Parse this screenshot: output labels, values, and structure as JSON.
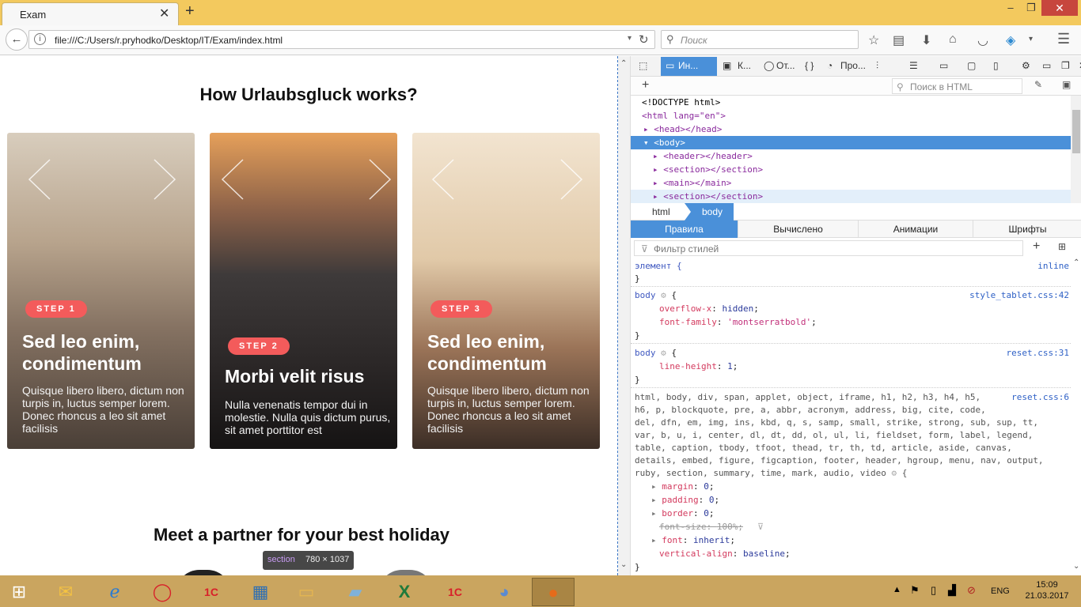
{
  "browser": {
    "tab_title": "Exam",
    "tab_close": "✕",
    "new_tab": "+",
    "url": "file:///C:/Users/r.pryhodko/Desktop/IT/Exam/index.html",
    "search_placeholder": "Поиск",
    "window_controls": [
      "–",
      "❐"
    ],
    "window_close": "✕"
  },
  "page": {
    "heading": "How Urlaubsgluck works?",
    "cards": [
      {
        "step": "STEP 1",
        "title": "Sed leo enim, condimentum",
        "text": "Quisque libero libero, dictum non turpis in, luctus semper lorem. Donec rhoncus a leo sit amet facilisis"
      },
      {
        "step": "STEP 2",
        "title": "Morbi velit risus",
        "text": "Nulla venenatis tempor dui in molestie. Nulla quis dictum purus, sit amet porttitor est"
      },
      {
        "step": "STEP 3",
        "title": "Sed leo enim, condimentum",
        "text": "Quisque libero libero, dictum non turpis in, luctus semper lorem. Donec rhoncus a leo sit amet facilisis"
      }
    ],
    "heading2": "Meet a partner for your best holiday",
    "tooltip_tag": "section",
    "tooltip_size": "780 × 1037"
  },
  "devtools": {
    "tabs": [
      "Ин...",
      "К...",
      "От...",
      "Про..."
    ],
    "html_search": "Поиск в HTML",
    "markup": [
      "<!DOCTYPE html>",
      "<html lang=\"en\">",
      "▸ <head></head>",
      "▾ <body>",
      "▸ <header></header>",
      "▸ <section></section>",
      "▸ <main></main>",
      "▸ <section></section>"
    ],
    "breadcrumb_html": "html",
    "breadcrumb_body": "body",
    "style_tabs": [
      "Правила",
      "Вычислено",
      "Анимации",
      "Шрифты"
    ],
    "filter_placeholder": "Фильтр стилей",
    "rules": {
      "r1_sel": "элемент {",
      "r1_src": "inline",
      "close": "}",
      "r2_sel": "body",
      "r2_src": "style_tablet.css:42",
      "r2_p1": "overflow-x",
      "r2_v1": "hidden",
      "r2_p2": "font-family",
      "r2_v2": "'montserratbold'",
      "r3_sel": "body",
      "r3_src": "reset.css:31",
      "r3_p1": "line-height",
      "r3_v1": "1",
      "r4_src": "reset.css:6",
      "r4_sel_lines": [
        "html, body, div, span, applet, object, iframe, h1, h2, h3, h4, h5,",
        "h6, p, blockquote, pre, a, abbr, acronym, address, big, cite, code,",
        "del, dfn, em, img, ins, kbd, q, s, samp, small, strike, strong, sub, sup, tt,",
        "var, b, u, i, center, dl, dt, dd, ol, ul, li, fieldset, form, label, legend,",
        "table, caption, tbody, tfoot, thead, tr, th, td, article, aside, canvas,",
        "details, embed, figure, figcaption, footer, header, hgroup, menu, nav, output,",
        "ruby, section, summary, time, mark, audio, video"
      ],
      "r4_p1": "margin",
      "r4_v1": "0",
      "r4_p2": "padding",
      "r4_v2": "0",
      "r4_p3": "border",
      "r4_v3": "0",
      "r4_p4": "font-size",
      "r4_v4": "100%",
      "r4_p5": "font",
      "r4_v5": "inherit",
      "r4_p6": "vertical-align",
      "r4_v6": "baseline"
    }
  },
  "taskbar": {
    "lang": "ENG",
    "time": "15:09",
    "date": "21.03.2017"
  }
}
